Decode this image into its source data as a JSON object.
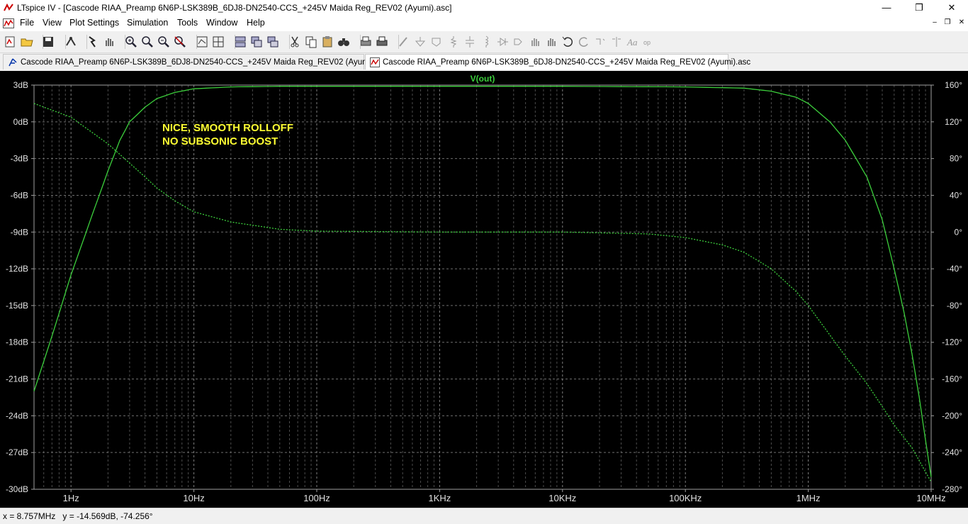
{
  "window": {
    "title": "LTspice IV - [Cascode RIAA_Preamp 6N6P-LSK389B_6DJ8-DN2540-CCS_+245V Maida Reg_REV02 (Ayumi).asc]",
    "controls": [
      "—",
      "❐",
      "✕"
    ]
  },
  "menu": [
    "File",
    "View",
    "Plot Settings",
    "Simulation",
    "Tools",
    "Window",
    "Help"
  ],
  "mdi_controls": [
    "–",
    "❐",
    "✕"
  ],
  "toolbar_icons": [
    "new-schematic-icon",
    "open-icon",
    "save-icon",
    "control-panel-icon",
    "run-icon",
    "pan-icon",
    "zoom-in-icon",
    "zoom-area-icon",
    "zoom-out-icon",
    "zoom-cancel-icon",
    "autorange-icon",
    "cursor-icon",
    "tile-horizontal-icon",
    "cascade-icon",
    "tile-vertical-icon",
    "cut-icon",
    "copy-icon",
    "paste-icon",
    "find-icon",
    "print-preview-icon",
    "print-icon",
    "wire-icon",
    "ground-icon",
    "label-icon",
    "resistor-icon",
    "capacitor-icon",
    "inductor-icon",
    "diode-icon",
    "component-icon",
    "move-icon",
    "drag-icon",
    "undo-icon",
    "redo-icon",
    "rotate-icon",
    "mirror-icon",
    "text-icon",
    "spice-directive-icon"
  ],
  "tabs": [
    {
      "label": "Cascode RIAA_Preamp 6N6P-LSK389B_6DJ8-DN2540-CCS_+245V Maida Reg_REV02 (Ayumi).asc",
      "active": false
    },
    {
      "label": "Cascode RIAA_Preamp 6N6P-LSK389B_6DJ8-DN2540-CCS_+245V Maida Reg_REV02 (Ayumi).asc",
      "active": true
    }
  ],
  "plot": {
    "trace_name": "V(out)",
    "annotation_line1": "NICE, SMOOTH ROLLOFF",
    "annotation_line2": "NO SUBSONIC BOOST",
    "colors": {
      "background": "#000000",
      "trace": "#3ccf3c",
      "axis_text": "#e0e0e0",
      "annotation": "#ffff33",
      "grid": "#8a8a8a"
    }
  },
  "chart_data": {
    "type": "line",
    "x_scale": "log",
    "xlim": [
      0.5,
      10000000
    ],
    "x_ticks": [
      {
        "v": 1,
        "label": "1Hz"
      },
      {
        "v": 10,
        "label": "10Hz"
      },
      {
        "v": 100,
        "label": "100Hz"
      },
      {
        "v": 1000,
        "label": "1KHz"
      },
      {
        "v": 10000,
        "label": "10KHz"
      },
      {
        "v": 100000,
        "label": "100KHz"
      },
      {
        "v": 1000000,
        "label": "1MHz"
      },
      {
        "v": 10000000,
        "label": "10MHz"
      }
    ],
    "ylim_left": [
      -30,
      3
    ],
    "y_ticks_left": [
      "3dB",
      "0dB",
      "-3dB",
      "-6dB",
      "-9dB",
      "-12dB",
      "-15dB",
      "-18dB",
      "-21dB",
      "-24dB",
      "-27dB",
      "-30dB"
    ],
    "ylim_right": [
      -280,
      160
    ],
    "y_ticks_right": [
      "160°",
      "120°",
      "80°",
      "40°",
      "0°",
      "-40°",
      "-80°",
      "-120°",
      "-160°",
      "-200°",
      "-240°",
      "-280°"
    ],
    "grid": true,
    "series": [
      {
        "name": "V(out)",
        "style": "solid",
        "axis": "left",
        "points": [
          [
            0.5,
            -22
          ],
          [
            0.7,
            -17.5
          ],
          [
            1,
            -12.5
          ],
          [
            1.5,
            -7.5
          ],
          [
            2,
            -4
          ],
          [
            2.5,
            -1.5
          ],
          [
            3,
            0
          ],
          [
            4,
            1.2
          ],
          [
            5,
            1.9
          ],
          [
            7,
            2.4
          ],
          [
            10,
            2.7
          ],
          [
            20,
            2.85
          ],
          [
            50,
            2.9
          ],
          [
            100,
            2.9
          ],
          [
            1000,
            2.9
          ],
          [
            10000,
            2.9
          ],
          [
            100000,
            2.85
          ],
          [
            300000,
            2.75
          ],
          [
            500000,
            2.5
          ],
          [
            800000,
            2.0
          ],
          [
            1000000,
            1.5
          ],
          [
            1500000,
            0
          ],
          [
            2000000,
            -1.5
          ],
          [
            3000000,
            -4.5
          ],
          [
            4000000,
            -8
          ],
          [
            5000000,
            -12
          ],
          [
            6000000,
            -15.5
          ],
          [
            7000000,
            -19
          ],
          [
            8000000,
            -22.5
          ],
          [
            9000000,
            -26
          ],
          [
            10000000,
            -29
          ]
        ]
      },
      {
        "name": "phase",
        "style": "dotted",
        "axis": "right",
        "points": [
          [
            0.5,
            140
          ],
          [
            1,
            125
          ],
          [
            2,
            96
          ],
          [
            3,
            75
          ],
          [
            4,
            60
          ],
          [
            5,
            48
          ],
          [
            7,
            34
          ],
          [
            10,
            22
          ],
          [
            20,
            11
          ],
          [
            50,
            3
          ],
          [
            100,
            1
          ],
          [
            1000,
            0
          ],
          [
            10000,
            0
          ],
          [
            50000,
            -2
          ],
          [
            100000,
            -6
          ],
          [
            200000,
            -14
          ],
          [
            300000,
            -22
          ],
          [
            500000,
            -40
          ],
          [
            800000,
            -65
          ],
          [
            1000000,
            -80
          ],
          [
            2000000,
            -135
          ],
          [
            3000000,
            -165
          ],
          [
            4000000,
            -190
          ],
          [
            5000000,
            -210
          ],
          [
            7000000,
            -235
          ],
          [
            10000000,
            -272
          ]
        ]
      }
    ]
  },
  "status": {
    "x": "x = 8.757MHz",
    "y": "y = -14.569dB, -74.256°"
  }
}
